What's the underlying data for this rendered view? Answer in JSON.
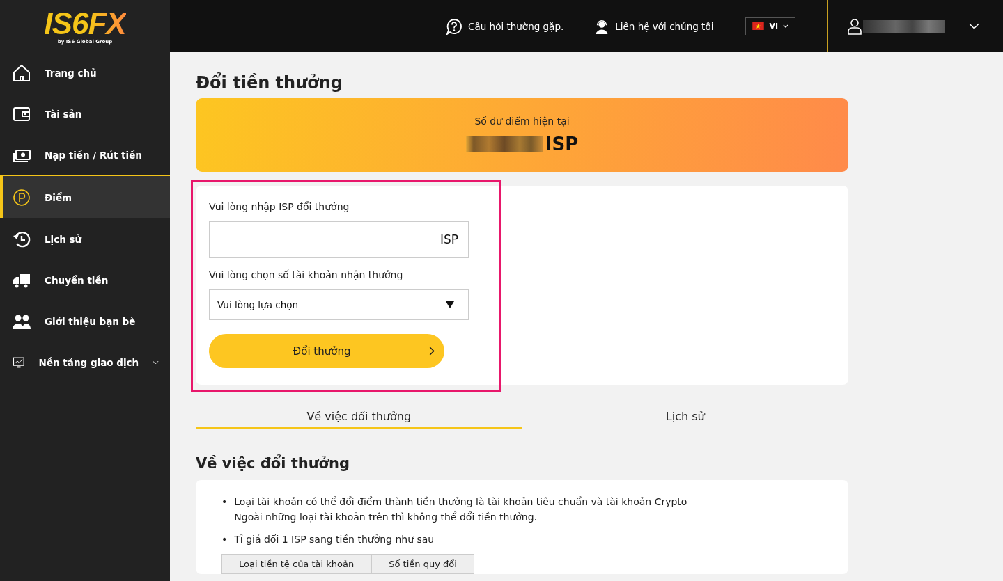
{
  "logo": {
    "text": "IS6FX",
    "tagline": "by IS6 Global Group"
  },
  "header": {
    "faq": "Câu hỏi thường gặp.",
    "contact": "Liên hệ với chúng tôi",
    "language": "VI"
  },
  "sidebar": {
    "items": [
      {
        "label": "Trang chủ",
        "selected": false
      },
      {
        "label": "Tài sản",
        "selected": false
      },
      {
        "label": "Nạp tiền / Rút tiền",
        "selected": false
      },
      {
        "label": "Điểm",
        "selected": true
      },
      {
        "label": "Lịch sử",
        "selected": false
      },
      {
        "label": "Chuyển tiền",
        "selected": false
      },
      {
        "label": "Giới thiệu bạn bè",
        "selected": false
      },
      {
        "label": "Nền tảng giao dịch",
        "selected": false,
        "expandable": true
      }
    ]
  },
  "page_title": "Đổi tiền thưởng",
  "balance": {
    "label": "Số dư điểm hiện tại",
    "unit": "ISP"
  },
  "form": {
    "amount_label": "Vui lòng nhập ISP đổi thưởng",
    "amount_unit": "ISP",
    "account_label": "Vui lòng chọn số tài khoản nhận thưởng",
    "account_value": "Vui lòng lựa chọn",
    "submit": "Đổi thưởng"
  },
  "tabs": [
    {
      "label": "Về việc đổi thưởng",
      "selected": true
    },
    {
      "label": "Lịch sử",
      "selected": false
    }
  ],
  "section_title": "Về việc đổi thưởng",
  "bullets": [
    {
      "marker": "•",
      "lines": [
        "Loại tài khoản có thể đổi điểm thành tiền thưởng là tài khoản tiêu chuẩn và tài khoản Crypto",
        "Ngoài những loại tài khoản trên thì không thể đổi tiền thưởng."
      ]
    },
    {
      "marker": "•",
      "lines": [
        "Tỉ giá đổi 1 ISP sang tiền thưởng như sau"
      ]
    }
  ],
  "rate_table": {
    "columns": [
      "Loại tiền tệ của tài khoản",
      "Số tiền quy đổi"
    ]
  }
}
